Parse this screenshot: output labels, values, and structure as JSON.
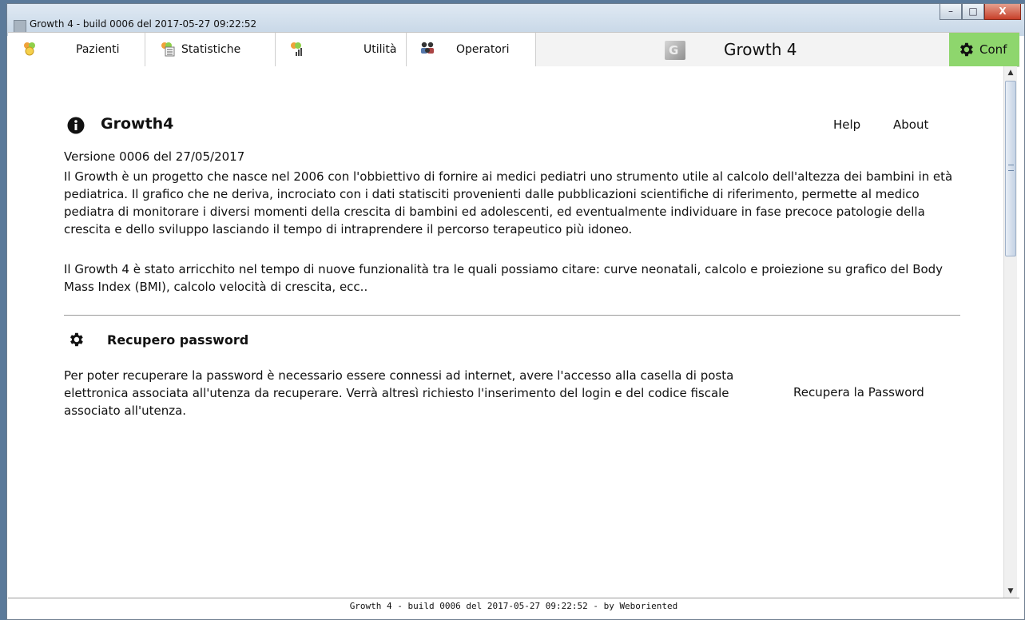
{
  "window": {
    "title": "Growth 4 - build 0006 del 2017-05-27 09:22:52"
  },
  "menu": {
    "items": [
      {
        "label": "Pazienti",
        "icon": "patients-icon"
      },
      {
        "label": "Statistiche",
        "icon": "statistics-icon"
      },
      {
        "label": "Utilità",
        "icon": "utilities-icon"
      },
      {
        "label": "Operatori",
        "icon": "operators-icon"
      }
    ],
    "brand": "Growth 4",
    "logo_text": "G",
    "conf_label": "Conf"
  },
  "main": {
    "title": "Growth4",
    "help_link": "Help",
    "about_link": "About",
    "version": "Versione 0006 del 27/05/2017",
    "paragraph1": "Il Growth è un progetto che nasce nel 2006 con l'obbiettivo di fornire ai medici pediatri uno strumento utile al calcolo dell'altezza dei bambini in età pediatrica. Il grafico che ne deriva, incrociato con i dati statisciti provenienti dalle pubblicazioni scientifiche di riferimento, permette al medico pediatra di monitorare i diversi momenti della crescita di bambini ed adolescenti, ed eventualmente individuare in fase precoce patologie della crescita e dello sviluppo lasciando il tempo di intraprendere il percorso terapeutico più idoneo.",
    "paragraph2": "Il Growth 4 è stato arricchito nel tempo di nuove funzionalità tra le quali possiamo citare: curve neonatali, calcolo e proiezione su grafico del Body Mass Index (BMI), calcolo velocità di crescita, ecc..",
    "recovery_title": "Recupero password",
    "recovery_text": "Per poter recuperare la password è necessario essere connessi ad internet, avere l'accesso alla casella di posta elettronica associata all'utenza da recuperare. Verrà altresì richiesto l'inserimento del login e del codice fiscale associato all'utenza.",
    "recovery_link": "Recupera la Password"
  },
  "status": {
    "text": "Growth 4 - build 0006 del 2017-05-27 09:22:52 - by Weboriented"
  },
  "colors": {
    "conf_bg": "#8ed66d",
    "menubar_bg": "#f3f3f3"
  }
}
